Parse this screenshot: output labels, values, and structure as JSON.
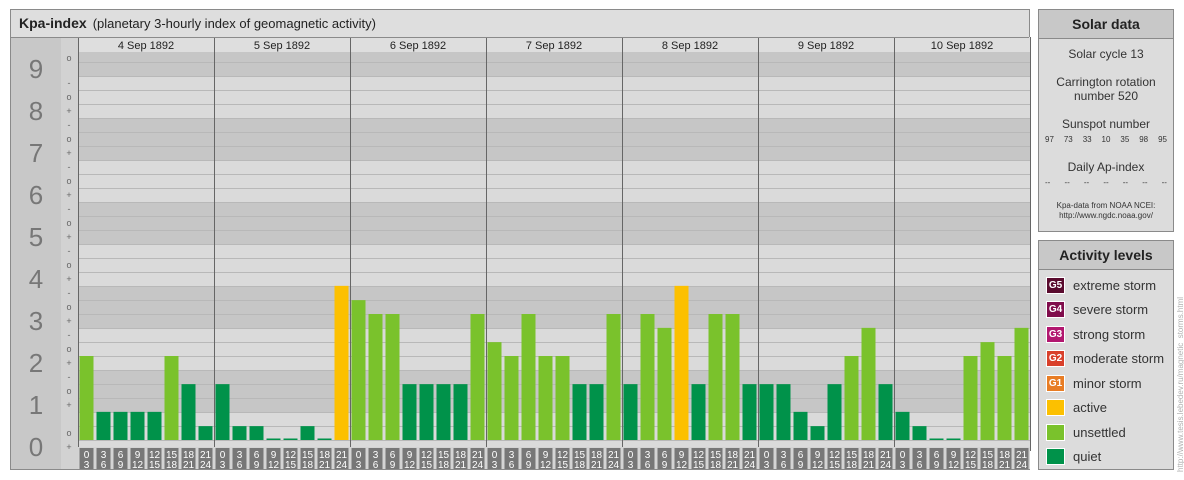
{
  "header": {
    "title": "Kpa-index",
    "subtitle": "(planetary 3-hourly index of geomagnetic activity)"
  },
  "chart_data": {
    "type": "bar",
    "days": [
      "4 Sep 1892",
      "5 Sep 1892",
      "6 Sep 1892",
      "7 Sep 1892",
      "8 Sep 1892",
      "9 Sep 1892",
      "10 Sep 1892"
    ],
    "hour_labels_top": [
      "0",
      "3",
      "6",
      "9",
      "12",
      "15",
      "18",
      "21"
    ],
    "hour_labels_bottom": [
      "3",
      "6",
      "9",
      "12",
      "15",
      "18",
      "21",
      "24"
    ],
    "y_labels": [
      "0",
      "1",
      "2",
      "3",
      "4",
      "5",
      "6",
      "7",
      "8",
      "9"
    ],
    "sub_labels": [
      "+",
      "o",
      "-"
    ],
    "ylim": [
      0,
      9.33
    ],
    "values": [
      2.0,
      0.67,
      0.67,
      0.67,
      0.67,
      2.0,
      1.33,
      0.33,
      1.33,
      0.33,
      0.33,
      0.0,
      0.0,
      0.33,
      0.0,
      3.67,
      3.33,
      3.0,
      3.0,
      1.33,
      1.33,
      1.33,
      1.33,
      3.0,
      2.33,
      2.0,
      3.0,
      2.0,
      2.0,
      1.33,
      1.33,
      3.0,
      1.33,
      3.0,
      2.67,
      3.67,
      1.33,
      3.0,
      3.0,
      1.33,
      1.33,
      1.33,
      0.67,
      0.33,
      1.33,
      2.0,
      2.67,
      1.33,
      0.67,
      0.33,
      0.0,
      0.0,
      2.0,
      2.33,
      2.0,
      2.67
    ],
    "colors": {
      "quiet": "#00924a",
      "unsettled": "#7ac22c",
      "active": "#fcc000"
    }
  },
  "solar": {
    "title": "Solar data",
    "cycle": "Solar cycle 13",
    "carrington": "Carrington rotation number 520",
    "sunspot_title": "Sunspot number",
    "sunspots": [
      "97",
      "73",
      "33",
      "10",
      "35",
      "98",
      "95"
    ],
    "ap_title": "Daily Ap-index",
    "ap_values": [
      "--",
      "--",
      "--",
      "--",
      "--",
      "--",
      "--"
    ],
    "note_line1": "Kpa-data from NOAA NCEI:",
    "note_line2": "http://www.ngdc.noaa.gov/"
  },
  "activity": {
    "title": "Activity levels",
    "levels": [
      {
        "code": "G5",
        "label": "extreme storm",
        "color": "#5a0b2e"
      },
      {
        "code": "G4",
        "label": "severe storm",
        "color": "#800d4c"
      },
      {
        "code": "G3",
        "label": "strong storm",
        "color": "#b2176f"
      },
      {
        "code": "G2",
        "label": "moderate storm",
        "color": "#d9402b"
      },
      {
        "code": "G1",
        "label": "minor storm",
        "color": "#e87d25"
      },
      {
        "code": "",
        "label": "active",
        "color": "#fcc000"
      },
      {
        "code": "",
        "label": "unsettled",
        "color": "#7ac22c"
      },
      {
        "code": "",
        "label": "quiet",
        "color": "#00924a"
      }
    ]
  },
  "watermark": "http://www.tesis.lebedev.ru/magnetic_storms.html"
}
